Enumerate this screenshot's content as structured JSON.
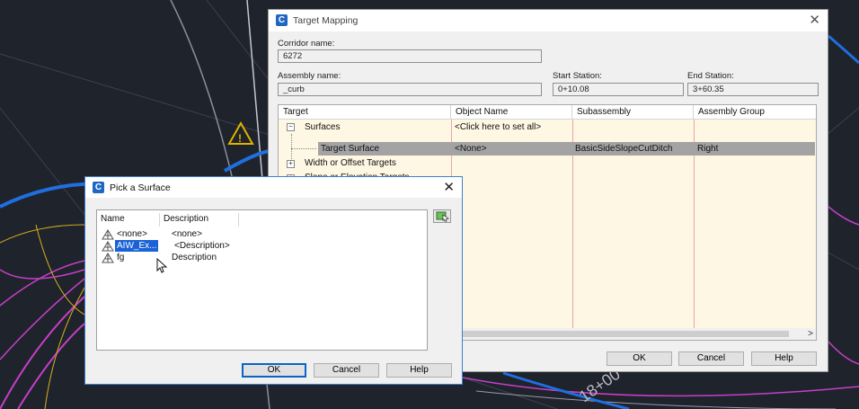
{
  "target_mapping": {
    "title": "Target Mapping",
    "corridor_name_label": "Corridor name:",
    "corridor_name_value": "6272",
    "assembly_name_label": "Assembly name:",
    "assembly_name_value": "_curb",
    "start_station_label": "Start Station:",
    "start_station_value": "0+10.08",
    "end_station_label": "End Station:",
    "end_station_value": "3+60.35",
    "columns": [
      "Target",
      "Object Name",
      "Subassembly",
      "Assembly Group"
    ],
    "rows": [
      {
        "target": "Surfaces",
        "object_name": "<Click here to set all>",
        "subassembly": "",
        "group": "",
        "expander": "−"
      },
      {
        "target": "Target Surface",
        "object_name": "<None>",
        "subassembly": "BasicSideSlopeCutDitch",
        "group": "Right",
        "selected": true
      },
      {
        "target": "Width or Offset Targets",
        "object_name": "",
        "subassembly": "",
        "group": "",
        "expander": "+"
      },
      {
        "target": "Slope or Elevation Targets",
        "object_name": "",
        "subassembly": "",
        "group": "",
        "expander": "+"
      }
    ],
    "scroll_arrow": ">",
    "ok_label": "OK",
    "cancel_label": "Cancel",
    "help_label": "Help"
  },
  "pick_surface": {
    "title": "Pick a Surface",
    "columns": [
      "Name",
      "Description"
    ],
    "items": [
      {
        "name": "<none>",
        "description": "<none>"
      },
      {
        "name": "AIW_Ex...",
        "description": "<Description>",
        "selected": true
      },
      {
        "name": "fg",
        "description": "Description"
      }
    ],
    "ok_label": "OK",
    "cancel_label": "Cancel",
    "help_label": "Help"
  },
  "background": {
    "station_label": "18+00"
  },
  "icons": {
    "app": "civil3d-app-icon",
    "close": "close-icon",
    "surface": "surface-icon",
    "pick_from_drawing": "pick-from-drawing-icon",
    "cursor": "mouse-cursor-icon",
    "warning": "warning-icon"
  },
  "colors": {
    "cad_background": "#1f232b",
    "selection_blue": "#1a62d6",
    "selected_row_gray": "#a3a3a3",
    "grid_cell_bg": "#fdf7e3",
    "magenta_lines": "#c53fc8",
    "blue_lines": "#1f6fe0",
    "yellow_lines": "#d6b21f"
  }
}
